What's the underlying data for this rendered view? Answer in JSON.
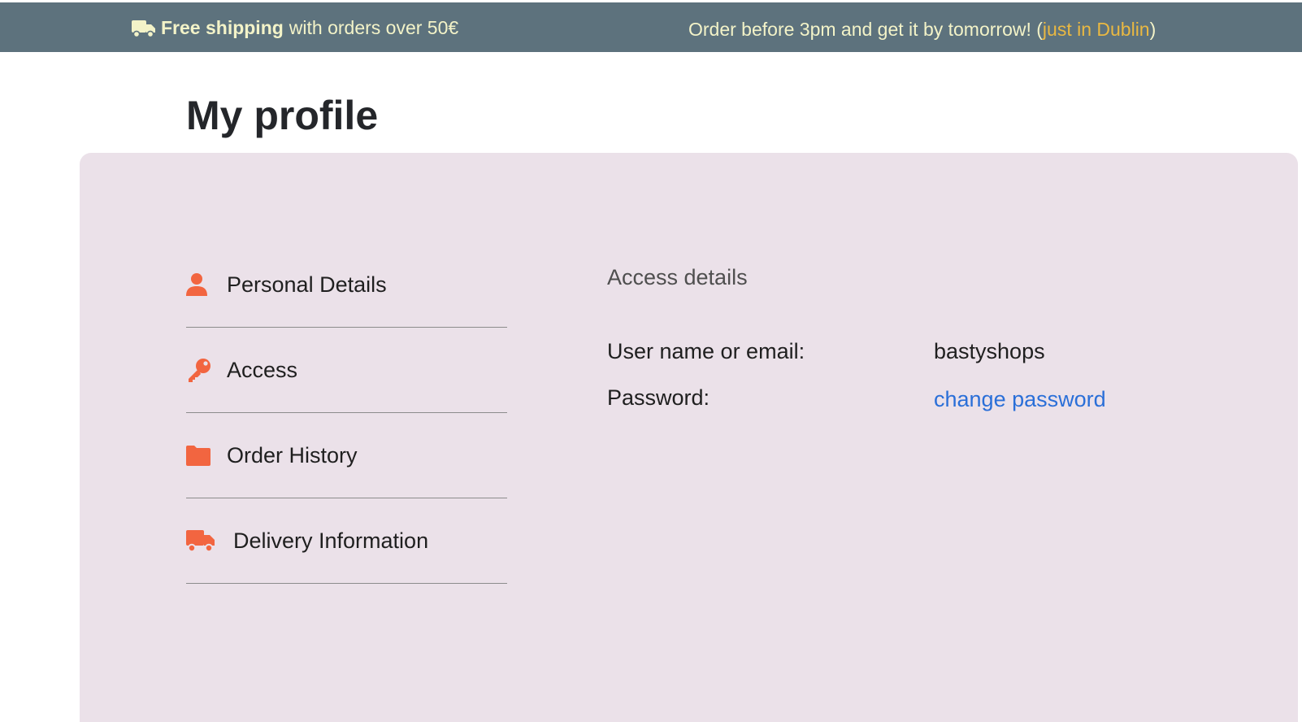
{
  "banner": {
    "shipping_bold": "Free shipping",
    "shipping_rest": "with orders over 50€",
    "order_text": "Order before 3pm and get it by tomorrow! (",
    "dublin_text": "just in Dublin",
    "order_close": ")",
    "colors": {
      "background": "#5d727d",
      "text": "#f3f3c8",
      "highlight": "#e9b842"
    }
  },
  "page": {
    "title": "My profile"
  },
  "sidebar": {
    "accent_color": "#f26540",
    "items": [
      {
        "label": "Personal Details",
        "icon": "user-icon"
      },
      {
        "label": "Access",
        "icon": "key-icon"
      },
      {
        "label": "Order History",
        "icon": "folder-icon"
      },
      {
        "label": "Delivery Information",
        "icon": "truck-icon"
      }
    ]
  },
  "access": {
    "title": "Access details",
    "username_label": "User name or email:",
    "username_value": "bastyshops",
    "password_label": "Password:",
    "password_link": "change password"
  }
}
